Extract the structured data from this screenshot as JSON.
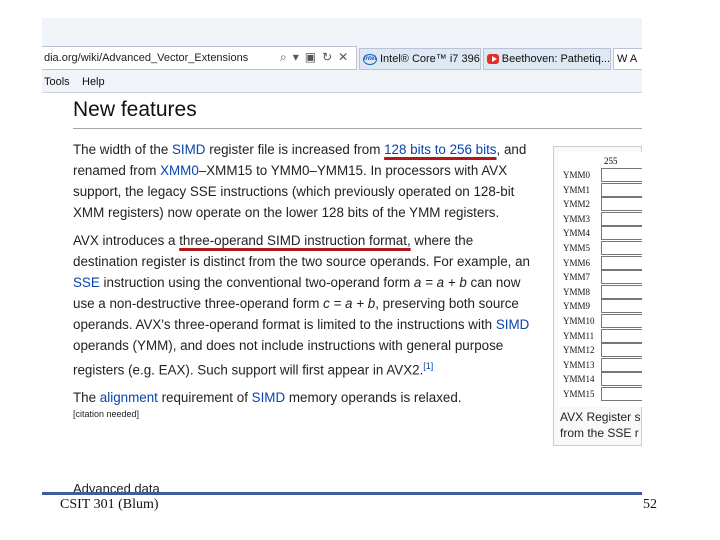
{
  "browser": {
    "url": "dia.org/wiki/Advanced_Vector_Extensions",
    "tabs": [
      {
        "label": "Intel® Core™ i7 396...",
        "icon": "intel-icon"
      },
      {
        "label": "Beethoven: Pathetiq...",
        "icon": "youtube-icon"
      },
      {
        "label": "W A",
        "icon": "wikipedia-icon"
      }
    ],
    "menu": {
      "tools": "Tools",
      "help": "Help"
    }
  },
  "article": {
    "heading": "New features",
    "p1": {
      "t1": "The width of the ",
      "l1": "SIMD",
      "t2": " register file is increased from ",
      "u1": "128 bits to 256 bits",
      "t3": ", and renamed from ",
      "l2": "XMM0",
      "t4": "–XMM15 to YMM0–YMM15. In processors with AVX support, the legacy SSE instructions (which previously operated on 128-bit XMM registers) now operate on the lower 128 bits of the YMM registers."
    },
    "p2": {
      "t1": "AVX introduces a ",
      "u1": "three-operand SIMD instruction format,",
      "t2": " where the destination register is distinct from the two source operands. For example, an ",
      "l1": "SSE",
      "t3": " instruction using the conventional two-operand form ",
      "e1": "a = a + b",
      "t4": " can now use a non-destructive three-operand form ",
      "e2": "c = a + b",
      "t5": ", preserving both source operands. AVX's three-operand format is limited to the instructions with ",
      "l2": "SIMD",
      "t6": " operands (YMM), and does not include instructions with general purpose registers (e.g. EAX). Such support will first appear in AVX2.",
      "ref": "[1]"
    },
    "p3": {
      "t1": "The ",
      "l1": "alignment",
      "t2": " requirement of ",
      "l2": "SIMD",
      "t3": " memory operands is relaxed."
    },
    "citation": "[citation needed]",
    "cutoff": "Advanced data permutation"
  },
  "figure": {
    "top_bit": "255",
    "registers": [
      "YMM0",
      "YMM1",
      "YMM2",
      "YMM3",
      "YMM4",
      "YMM5",
      "YMM6",
      "YMM7",
      "YMM8",
      "YMM9",
      "YMM10",
      "YMM11",
      "YMM12",
      "YMM13",
      "YMM14",
      "YMM15"
    ],
    "caption_line1": "AVX Register s",
    "caption_line2": "from the SSE r"
  },
  "slide": {
    "footer_left": "CSIT 301 (Blum)",
    "page_number": "52"
  },
  "colors": {
    "link": "#0645ad",
    "underline": "#b11a1a",
    "footer_rule": "#3f5f9a"
  }
}
